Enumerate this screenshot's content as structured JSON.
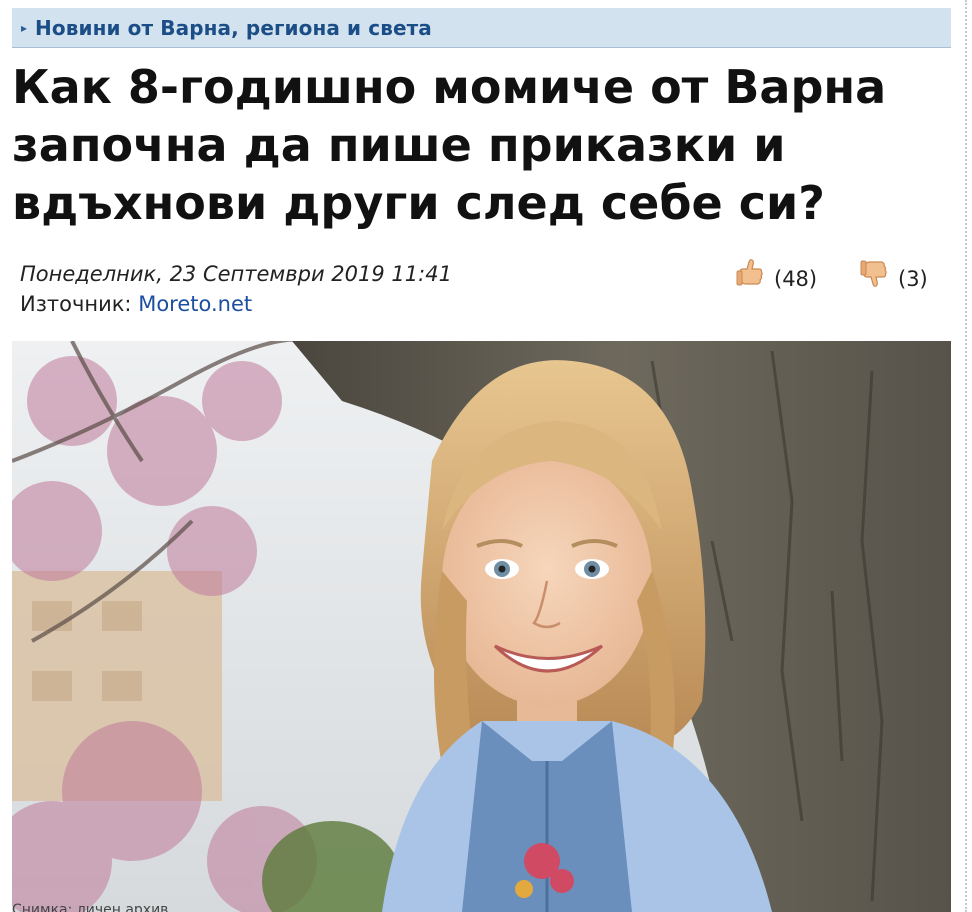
{
  "section": {
    "label": "Новини от Варна, региона и света",
    "arrow_icon": "chevron-right-icon"
  },
  "article": {
    "title": "Как 8-годишно момиче от Варна започна да пише приказки и вдъхнови други след себе си?",
    "date": "Понеделник, 23 Септември 2019 11:41",
    "source_label": "Източник:",
    "source_name": "Moreto.net"
  },
  "votes": {
    "up_icon": "thumbs-up-icon",
    "up_count": "(48)",
    "down_icon": "thumbs-down-icon",
    "down_count": "(3)"
  },
  "photo": {
    "caption": "Снимка: личен архив",
    "colors": {
      "sky": "#dfe3e6",
      "blossom": "#c07a9a",
      "bark": "#5e5a4f",
      "hair": "#d9b27a",
      "skin": "#f0c9a8",
      "cardigan": "#a9c4e6",
      "denim": "#6b8fbd"
    }
  },
  "colors": {
    "section_bg": "#d3e2ef",
    "section_text": "#1b4e86",
    "link": "#1d4fa0"
  }
}
